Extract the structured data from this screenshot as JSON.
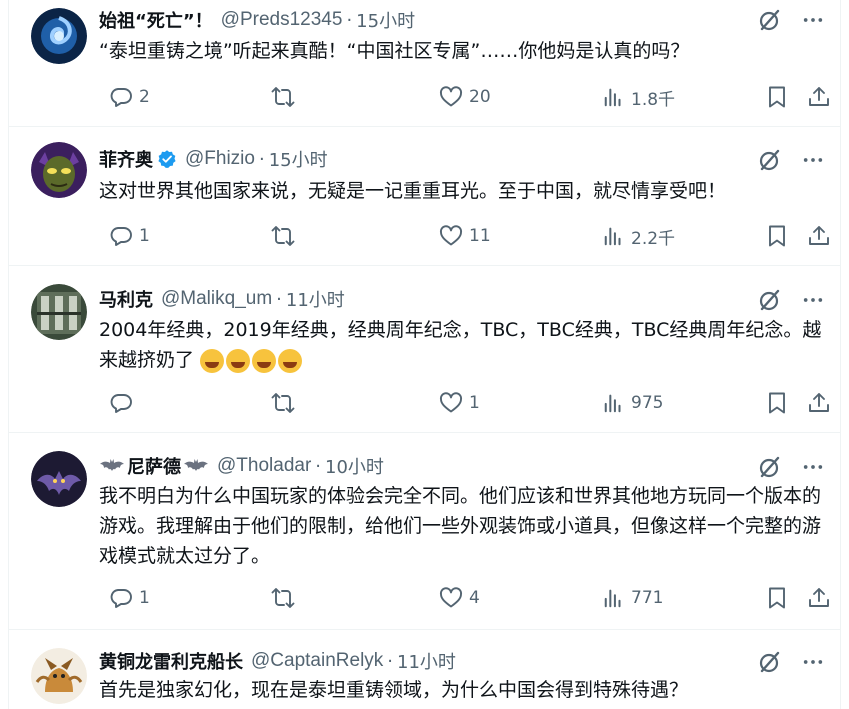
{
  "tweets": [
    {
      "name": "始祖“死亡”！",
      "handle": "@Preds12345",
      "time": "15小时",
      "text": "“泰坦重铸之境”听起来真酷！“中国社区专属”……你他妈是认真的吗？",
      "replies": "2",
      "retweets": "",
      "likes": "20",
      "views": "1.8千"
    },
    {
      "name": "菲齐奥",
      "handle": "@Fhizio",
      "time": "15小时",
      "verified": true,
      "text": "这对世界其他国家来说，无疑是一记重重耳光。至于中国，就尽情享受吧！",
      "replies": "1",
      "retweets": "",
      "likes": "11",
      "views": "2.2千"
    },
    {
      "name": "马利克",
      "handle": "@Malikq_um",
      "time": "11小时",
      "text": "2004年经典，2019年经典，经典周年纪念，TBC，TBC经典，TBC经典周年纪念。越来越挤奶了",
      "emoji": "🤣🤣🤣🤣",
      "replies": "",
      "retweets": "",
      "likes": "1",
      "views": "975"
    },
    {
      "name": "尼萨德",
      "handle": "@Tholadar",
      "time": "10小时",
      "text": "我不明白为什么中国玩家的体验会完全不同。他们应该和世界其他地方玩同一个版本的游戏。我理解由于他们的限制，给他们一些外观装饰或小道具，但像这样一个完整的游戏模式就太过分了。",
      "replies": "1",
      "retweets": "",
      "likes": "4",
      "views": "771"
    },
    {
      "name": "黄铜龙雷利克船长",
      "handle": "@CaptainRelyk",
      "time": "11小时",
      "text": "首先是独家幻化，现在是泰坦重铸领域，为什么中国会得到特殊待遇？"
    }
  ],
  "ui": {
    "dot": "·",
    "icons": [
      "grok-icon",
      "more-icon",
      "reply-icon",
      "retweet-icon",
      "like-icon",
      "views-icon",
      "bookmark-icon",
      "share-icon",
      "verified-badge-icon",
      "bat-icon"
    ],
    "colors": {
      "text": "#0f1419",
      "secondary": "#536471",
      "divider": "#eff3f4",
      "verified": "#1d9bf0"
    }
  }
}
